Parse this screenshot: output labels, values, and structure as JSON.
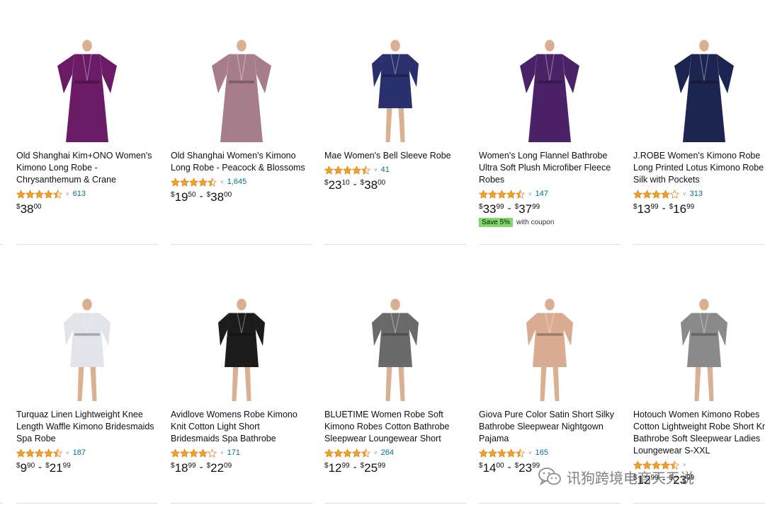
{
  "products": [
    {
      "title": "Old Shanghai Kim+ONO Women's Kimono Long Robe - Chrysanthemum & Crane",
      "rating": 4.5,
      "review_count": "613",
      "price_low": {
        "whole": "38",
        "frac": "00"
      },
      "price_high": null,
      "coupon": null,
      "image_icon": "purple-kimono-robe",
      "color": "#6b1a66"
    },
    {
      "title": "Old Shanghai Women's Kimono Long Robe - Peacock & Blossoms",
      "rating": 4.5,
      "review_count": "1,645",
      "price_low": {
        "whole": "19",
        "frac": "50"
      },
      "price_high": {
        "whole": "38",
        "frac": "00"
      },
      "coupon": null,
      "image_icon": "mauve-kimono-robe",
      "color": "#a77d8c"
    },
    {
      "title": "Mae Women's Bell Sleeve Robe",
      "rating": 4.5,
      "review_count": "41",
      "price_low": {
        "whole": "23",
        "frac": "10"
      },
      "price_high": {
        "whole": "38",
        "frac": "00"
      },
      "coupon": null,
      "image_icon": "navy-short-robe",
      "color": "#2a2f6e"
    },
    {
      "title": "Women's Long Flannel Bathrobe Ultra Soft Plush Microfiber Fleece Robes",
      "rating": 4.5,
      "review_count": "147",
      "price_low": {
        "whole": "33",
        "frac": "99"
      },
      "price_high": {
        "whole": "37",
        "frac": "99"
      },
      "coupon": {
        "badge": "Save 5%",
        "text": "with coupon"
      },
      "image_icon": "purple-flannel-robe",
      "color": "#4b2268"
    },
    {
      "title": "J.ROBE Women's Kimono Robe Long Printed Lotus Kimono Robe Silk with Pockets",
      "rating": 4.0,
      "review_count": "313",
      "price_low": {
        "whole": "13",
        "frac": "99"
      },
      "price_high": {
        "whole": "16",
        "frac": "99"
      },
      "coupon": null,
      "image_icon": "navy-floral-kimono",
      "color": "#1c2450"
    },
    {
      "title": "Turquaz Linen Lightweight Knee Length Waffle Kimono Bridesmaids Spa Robe",
      "rating": 4.5,
      "review_count": "187",
      "price_low": {
        "whole": "9",
        "frac": "90"
      },
      "price_high": {
        "whole": "21",
        "frac": "99"
      },
      "coupon": null,
      "image_icon": "white-waffle-robe",
      "color": "#e2e4ea"
    },
    {
      "title": "Avidlove Womens Robe Kimono Knit Cotton Light Short Bridesmaids Spa Bathrobe",
      "rating": 4.0,
      "review_count": "171",
      "price_low": {
        "whole": "18",
        "frac": "99"
      },
      "price_high": {
        "whole": "22",
        "frac": "09"
      },
      "coupon": null,
      "image_icon": "black-knit-robe",
      "color": "#1c1c1c"
    },
    {
      "title": "BLUETIME Women Robe Soft Kimono Robes Cotton Bathrobe Sleepwear Loungewear Short",
      "rating": 4.5,
      "review_count": "264",
      "price_low": {
        "whole": "12",
        "frac": "99"
      },
      "price_high": {
        "whole": "25",
        "frac": "99"
      },
      "coupon": null,
      "image_icon": "gray-cotton-robe",
      "color": "#6a6a6a"
    },
    {
      "title": "Giova Pure Color Satin Short Silky Bathrobe Sleepwear Nightgown Pajama",
      "rating": 4.5,
      "review_count": "165",
      "price_low": {
        "whole": "14",
        "frac": "00"
      },
      "price_high": {
        "whole": "23",
        "frac": "99"
      },
      "coupon": null,
      "image_icon": "champagne-satin-robe",
      "color": "#d9ab90"
    },
    {
      "title": "Hotouch Women Kimono Robes Cotton Lightweight Robe Short Knit Bathrobe Soft Sleepwear Ladies Loungewear S-XXL",
      "rating": 4.5,
      "review_count": "",
      "price_low": {
        "whole": "12",
        "frac": "99"
      },
      "price_high": {
        "whole": "23",
        "frac": "99"
      },
      "coupon": null,
      "image_icon": "gray-knit-robe",
      "color": "#8a8a8a"
    }
  ],
  "watermark": {
    "text": "讯狗跨境电商天天说",
    "icon": "wechat-icon"
  },
  "colors": {
    "star": "#f0a41c",
    "link": "#007185",
    "coupon_badge": "#7fda69",
    "separator": "#dddddd"
  }
}
